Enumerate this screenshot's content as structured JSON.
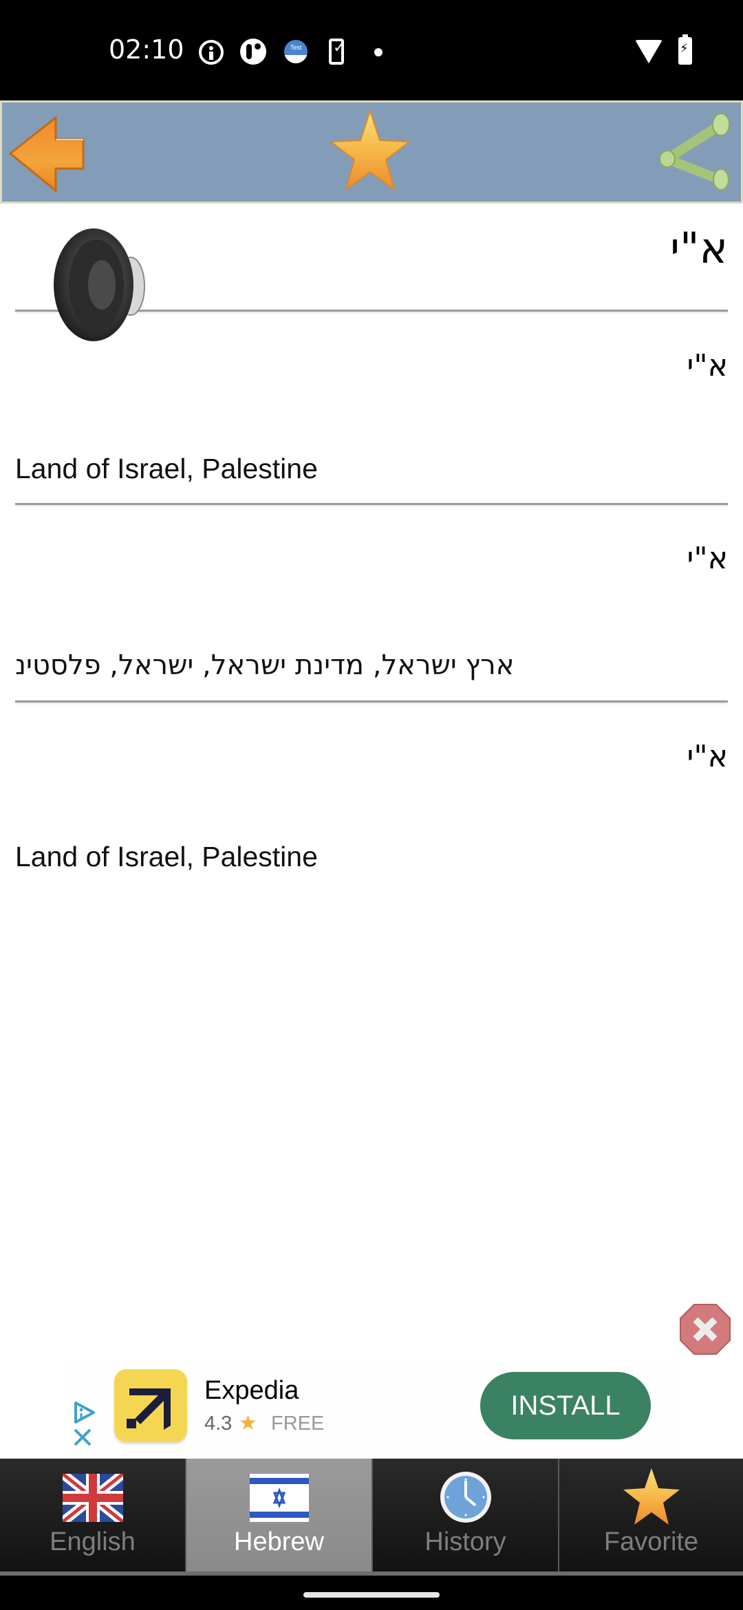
{
  "status_bar": {
    "time": "02:10",
    "icons": [
      "info-icon",
      "app-r-icon",
      "test-calendar-icon",
      "phone-check-icon",
      "notification-dot-icon",
      "wifi-icon",
      "battery-charging-icon"
    ],
    "test_label": "Test"
  },
  "toolbar": {
    "back_icon": "back-arrow-icon",
    "favorite_icon": "star-icon",
    "share_icon": "share-icon"
  },
  "headword": {
    "text": "א\"י",
    "speaker_icon": "speaker-icon"
  },
  "entries": [
    {
      "word": "א\"י",
      "translation": "Land of Israel, Palestine",
      "direction": "ltr"
    },
    {
      "word": "א\"י",
      "translation": "ארץ ישראל, מדינת ישראל, ישראל, פלסטינ",
      "direction": "rtl"
    },
    {
      "word": "א\"י",
      "translation": "Land of Israel, Palestine",
      "direction": "ltr"
    }
  ],
  "ad": {
    "app_name": "Expedia",
    "rating": "4.3",
    "price": "FREE",
    "cta": "INSTALL",
    "cta_color": "#3a8262",
    "icon_color": "#f5d652"
  },
  "tabs": [
    {
      "label": "English",
      "icon": "uk-flag-icon",
      "active": false
    },
    {
      "label": "Hebrew",
      "icon": "israel-flag-icon",
      "active": true
    },
    {
      "label": "History",
      "icon": "clock-icon",
      "active": false
    },
    {
      "label": "Favorite",
      "icon": "star-icon",
      "active": false
    }
  ],
  "colors": {
    "toolbar_bg": "#839db9",
    "toolbar_border": "#dedcc1",
    "tab_active_bg": "#9a9a9a",
    "tab_bg": "#1a1a1a"
  }
}
